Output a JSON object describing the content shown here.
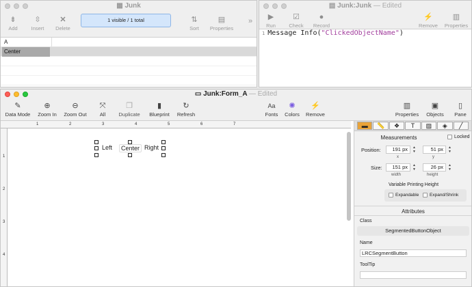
{
  "top_left_window": {
    "title": "Junk",
    "toolbar": {
      "add": "Add",
      "insert": "Insert",
      "delete": "Delete",
      "filter_status": "1 visible / 1 total",
      "sort": "Sort",
      "properties": "Properties",
      "overflow": "»"
    },
    "list": {
      "column_header": "A",
      "rows": [
        "Center"
      ]
    }
  },
  "top_right_window": {
    "title": "Junk:Junk",
    "edited": "— Edited",
    "toolbar": {
      "run": "Run",
      "check": "Check",
      "record": "Record",
      "remove": "Remove",
      "properties": "Properties"
    },
    "code": {
      "line_number": "1",
      "prefix": "Message Info(",
      "string": "\"ClickedObjectName\"",
      "suffix": ")"
    }
  },
  "form_window": {
    "title": "Junk:Form_A",
    "edited": "— Edited",
    "toolbar": {
      "data_mode": "Data Mode",
      "zoom_in": "Zoom In",
      "zoom_out": "Zoom Out",
      "all": "All",
      "duplicate": "Duplicate",
      "blueprint": "Blueprint",
      "refresh": "Refresh",
      "fonts": "Fonts",
      "fonts_icon_text": "Aa",
      "colors": "Colors",
      "remove": "Remove",
      "properties": "Properties",
      "objects": "Objects",
      "pane": "Pane"
    },
    "ruler_h": [
      "1",
      "2",
      "3",
      "4",
      "5",
      "6",
      "7"
    ],
    "ruler_v": [
      "1",
      "2",
      "3",
      "4"
    ],
    "segmented": {
      "left": "Left",
      "center": "Center",
      "right": "Right"
    },
    "side_panel": {
      "locked": "Locked",
      "measurements_title": "Measurements",
      "position_label": "Position:",
      "x_value": "191 px",
      "x_label": "x",
      "y_value": "51 px",
      "y_label": "y",
      "size_label": "Size:",
      "width_value": "151 px",
      "width_label": "width",
      "height_value": "26 px",
      "height_label": "height",
      "variable_printing": "Variable Printing Height",
      "expandable": "Expandable",
      "expand_shrink": "Expand/Shrink",
      "attributes_title": "Attributes",
      "class_label": "Class",
      "class_value": "SegmentedButtonObject",
      "name_label": "Name",
      "name_value": "LRCSegmentButton",
      "tooltip_label": "ToolTip",
      "tooltip_value": ""
    }
  },
  "colors": {
    "accent_blue": "#d4e6fb",
    "tab_selected": "#e8a33a"
  }
}
